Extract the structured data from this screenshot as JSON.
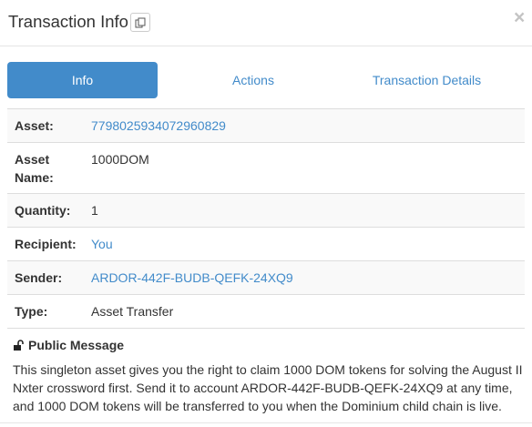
{
  "modal": {
    "title": "Transaction Info",
    "copy_icon": "copy-icon",
    "close_label": "×"
  },
  "tabs": [
    {
      "label": "Info",
      "active": true
    },
    {
      "label": "Actions",
      "active": false
    },
    {
      "label": "Transaction Details",
      "active": false
    }
  ],
  "fields": {
    "asset": {
      "key": "Asset:",
      "value": "7798025934072960829"
    },
    "asset_name": {
      "key_line1": "Asset",
      "key_line2": "Name:",
      "value": "1000DOM"
    },
    "quantity": {
      "key": "Quantity:",
      "value": "1"
    },
    "recipient": {
      "key": "Recipient:",
      "value": "You"
    },
    "sender": {
      "key": "Sender:",
      "value": "ARDOR-442F-BUDB-QEFK-24XQ9"
    },
    "type": {
      "key": "Type:",
      "value": "Asset Transfer"
    }
  },
  "message": {
    "icon": "unlock-icon",
    "heading": "Public Message",
    "body_line1": "This singleton asset gives you the right to claim 1000 DOM tokens for solving the August II",
    "body_line2": "Nxter crossword first. Send it to account ARDOR-442F-BUDB-QEFK-24XQ9 at any time,",
    "body_line3": "and 1000 DOM tokens will be transferred to you when the Dominium child chain is live."
  },
  "colors": {
    "accent": "#428bca",
    "text": "#333333",
    "stripe": "#f9f9f9",
    "border": "#dddddd"
  }
}
